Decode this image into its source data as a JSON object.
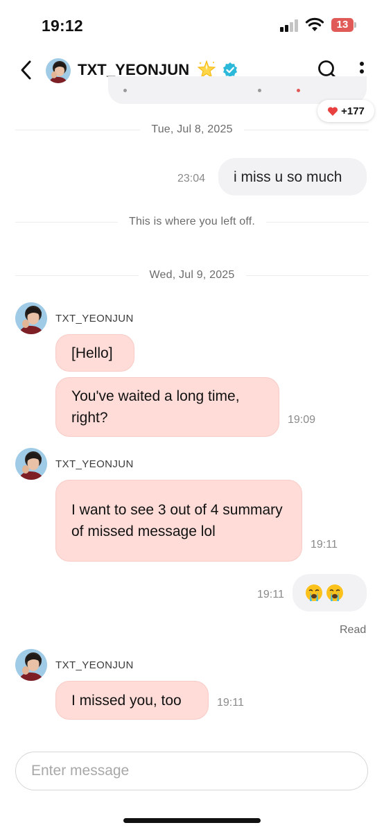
{
  "status_bar": {
    "time": "19:12",
    "battery": "13"
  },
  "header": {
    "name": "TXT_YEONJUN"
  },
  "reaction": {
    "count": "+177"
  },
  "dividers": {
    "date1": "Tue, Jul 8, 2025",
    "left_off": "This is where you left off.",
    "date2": "Wed, Jul 9, 2025"
  },
  "messages": [
    {
      "sender": "me",
      "text": "i miss u so much",
      "time": "23:04"
    },
    {
      "sender": "TXT_YEONJUN",
      "text": "[Hello]"
    },
    {
      "sender": "TXT_YEONJUN",
      "text": "You've waited a long time, right?",
      "time": "19:09"
    },
    {
      "sender": "TXT_YEONJUN",
      "text": "I want to see 3 out of 4 summary of missed message lol",
      "time": "19:11"
    },
    {
      "sender": "me",
      "text": "😭😭",
      "time": "19:11"
    },
    {
      "sender": "TXT_YEONJUN",
      "text": "I missed you, too",
      "time": "19:11"
    }
  ],
  "read_receipt": "Read",
  "input": {
    "placeholder": "Enter message",
    "value": ""
  },
  "colors": {
    "their_bubble": "#ffdcd8",
    "my_bubble": "#f2f2f5",
    "verified": "#2bb8d9",
    "heart": "#e8413f"
  },
  "icons": [
    "back-arrow-icon",
    "star-icon",
    "verified-badge-icon",
    "search-icon",
    "more-options-icon",
    "heart-icon",
    "crying-face-icon"
  ]
}
